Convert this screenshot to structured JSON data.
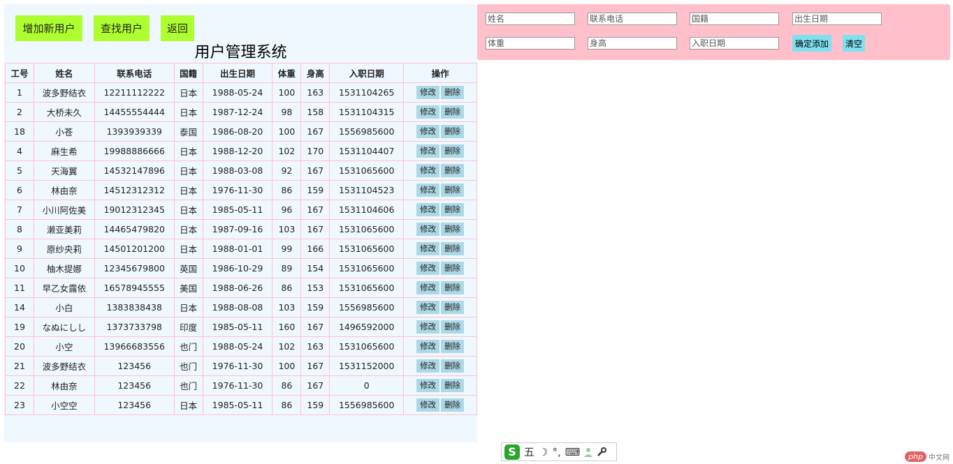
{
  "header": {
    "add_user_label": "增加新用户",
    "find_user_label": "查找用户",
    "back_label": "返回",
    "title": "用户管理系统"
  },
  "table": {
    "columns": [
      "工号",
      "姓名",
      "联系电话",
      "国籍",
      "出生日期",
      "体重",
      "身高",
      "入职日期",
      "操作"
    ],
    "edit_label": "修改",
    "delete_label": "删除",
    "rows": [
      {
        "id": "1",
        "name": "波多野结衣",
        "phone": "12211112222",
        "nation": "日本",
        "birth": "1988-05-24",
        "weight": "100",
        "height": "163",
        "hired": "1531104265"
      },
      {
        "id": "2",
        "name": "大桥未久",
        "phone": "14455554444",
        "nation": "日本",
        "birth": "1987-12-24",
        "weight": "98",
        "height": "158",
        "hired": "1531104315"
      },
      {
        "id": "18",
        "name": "小苍",
        "phone": "1393939339",
        "nation": "泰国",
        "birth": "1986-08-20",
        "weight": "100",
        "height": "167",
        "hired": "1556985600"
      },
      {
        "id": "4",
        "name": "麻生希",
        "phone": "19988886666",
        "nation": "日本",
        "birth": "1988-12-20",
        "weight": "102",
        "height": "170",
        "hired": "1531104407"
      },
      {
        "id": "5",
        "name": "天海翼",
        "phone": "14532147896",
        "nation": "日本",
        "birth": "1988-03-08",
        "weight": "92",
        "height": "167",
        "hired": "1531065600"
      },
      {
        "id": "6",
        "name": "林由奈",
        "phone": "14512312312",
        "nation": "日本",
        "birth": "1976-11-30",
        "weight": "86",
        "height": "159",
        "hired": "1531104523"
      },
      {
        "id": "7",
        "name": "小川阿佐美",
        "phone": "19012312345",
        "nation": "日本",
        "birth": "1985-05-11",
        "weight": "96",
        "height": "167",
        "hired": "1531104606"
      },
      {
        "id": "8",
        "name": "濑亚美莉",
        "phone": "14465479820",
        "nation": "日本",
        "birth": "1987-09-16",
        "weight": "103",
        "height": "167",
        "hired": "1531065600"
      },
      {
        "id": "9",
        "name": "原纱央莉",
        "phone": "14501201200",
        "nation": "日本",
        "birth": "1988-01-01",
        "weight": "99",
        "height": "166",
        "hired": "1531065600"
      },
      {
        "id": "10",
        "name": "柚木提娜",
        "phone": "12345679800",
        "nation": "英国",
        "birth": "1986-10-29",
        "weight": "89",
        "height": "154",
        "hired": "1531065600"
      },
      {
        "id": "11",
        "name": "早乙女露依",
        "phone": "16578945555",
        "nation": "美国",
        "birth": "1988-06-26",
        "weight": "86",
        "height": "153",
        "hired": "1531065600"
      },
      {
        "id": "14",
        "name": "小白",
        "phone": "1383838438",
        "nation": "日本",
        "birth": "1988-08-08",
        "weight": "103",
        "height": "159",
        "hired": "1556985600"
      },
      {
        "id": "19",
        "name": "なぬにしし",
        "phone": "1373733798",
        "nation": "印度",
        "birth": "1985-05-11",
        "weight": "160",
        "height": "167",
        "hired": "1496592000"
      },
      {
        "id": "20",
        "name": "小空",
        "phone": "13966683556",
        "nation": "也门",
        "birth": "1988-05-24",
        "weight": "102",
        "height": "163",
        "hired": "1531065600"
      },
      {
        "id": "21",
        "name": "波多野结衣",
        "phone": "123456",
        "nation": "也门",
        "birth": "1976-11-30",
        "weight": "100",
        "height": "167",
        "hired": "1531152000"
      },
      {
        "id": "22",
        "name": "林由奈",
        "phone": "123456",
        "nation": "也门",
        "birth": "1976-11-30",
        "weight": "86",
        "height": "167",
        "hired": "0"
      },
      {
        "id": "23",
        "name": "小空空",
        "phone": "123456",
        "nation": "日本",
        "birth": "1985-05-11",
        "weight": "86",
        "height": "159",
        "hired": "1556985600"
      }
    ]
  },
  "form": {
    "name_placeholder": "姓名",
    "phone_placeholder": "联系电话",
    "nation_placeholder": "国籍",
    "birth_placeholder": "出生日期",
    "weight_placeholder": "体重",
    "height_placeholder": "身高",
    "hired_placeholder": "入职日期",
    "confirm_label": "确定添加",
    "clear_label": "清空"
  },
  "ime": {
    "logo": "S",
    "mode": "五",
    "moon": "☽",
    "punct": "°,",
    "keyboard": "⌨",
    "user": "👤",
    "tool": "🔧"
  },
  "watermark": {
    "brand": "php",
    "site": "中文网"
  },
  "colors": {
    "top_button": "#adff2f",
    "panel_bg": "#f0f8ff",
    "form_bg": "#ffc0cb",
    "op_button": "#add8e6",
    "form_button": "#80e0f0",
    "table_border": "#ffc0cb"
  }
}
